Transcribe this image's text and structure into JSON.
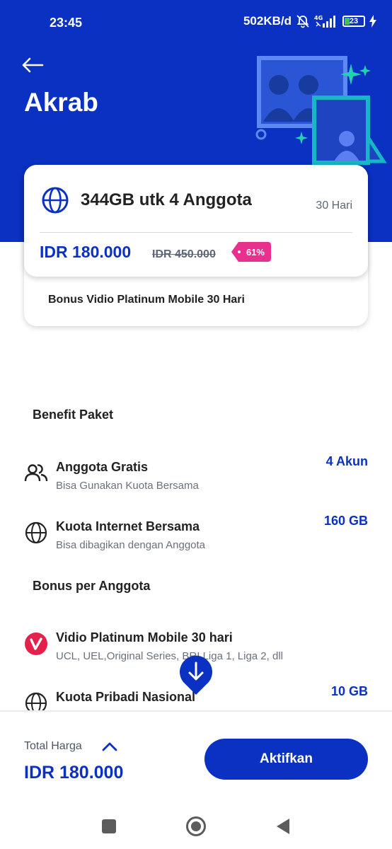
{
  "status_bar": {
    "time": "23:45",
    "speed": "502KB/d",
    "network": "4G",
    "battery": "23"
  },
  "header": {
    "title": "Akrab"
  },
  "package": {
    "name": "344GB utk 4 Anggota",
    "duration": "30 Hari",
    "price": "IDR 180.000",
    "old_price": "IDR 450.000",
    "discount": "61%",
    "bonus": "Bonus Vidio Platinum Mobile 30 Hari"
  },
  "benefit_section": {
    "title": "Benefit Paket",
    "items": [
      {
        "name": "Anggota Gratis",
        "desc": "Bisa Gunakan Kuota Bersama",
        "value": "4 Akun",
        "icon": "group-icon"
      },
      {
        "name": "Kuota Internet Bersama",
        "desc": "Bisa dibagikan dengan Anggota",
        "value": "160 GB",
        "icon": "globe-icon"
      }
    ]
  },
  "bonus_section": {
    "title": "Bonus per Anggota",
    "items": [
      {
        "name": "Vidio Platinum Mobile 30 hari",
        "desc": "UCL, UEL,Original Series, BRI Liga 1, Liga 2, dll",
        "value": "",
        "icon": "vidio-logo-icon"
      },
      {
        "name": "Kuota Pribadi Nasional",
        "desc": "",
        "value": "10 GB",
        "icon": "globe-icon"
      }
    ]
  },
  "footer": {
    "total_label": "Total Harga",
    "total_amount": "IDR 180.000",
    "activate_label": "Aktifkan"
  },
  "colors": {
    "primary": "#0a31c2",
    "discount": "#e8318e",
    "vidio": "#e5204a"
  }
}
